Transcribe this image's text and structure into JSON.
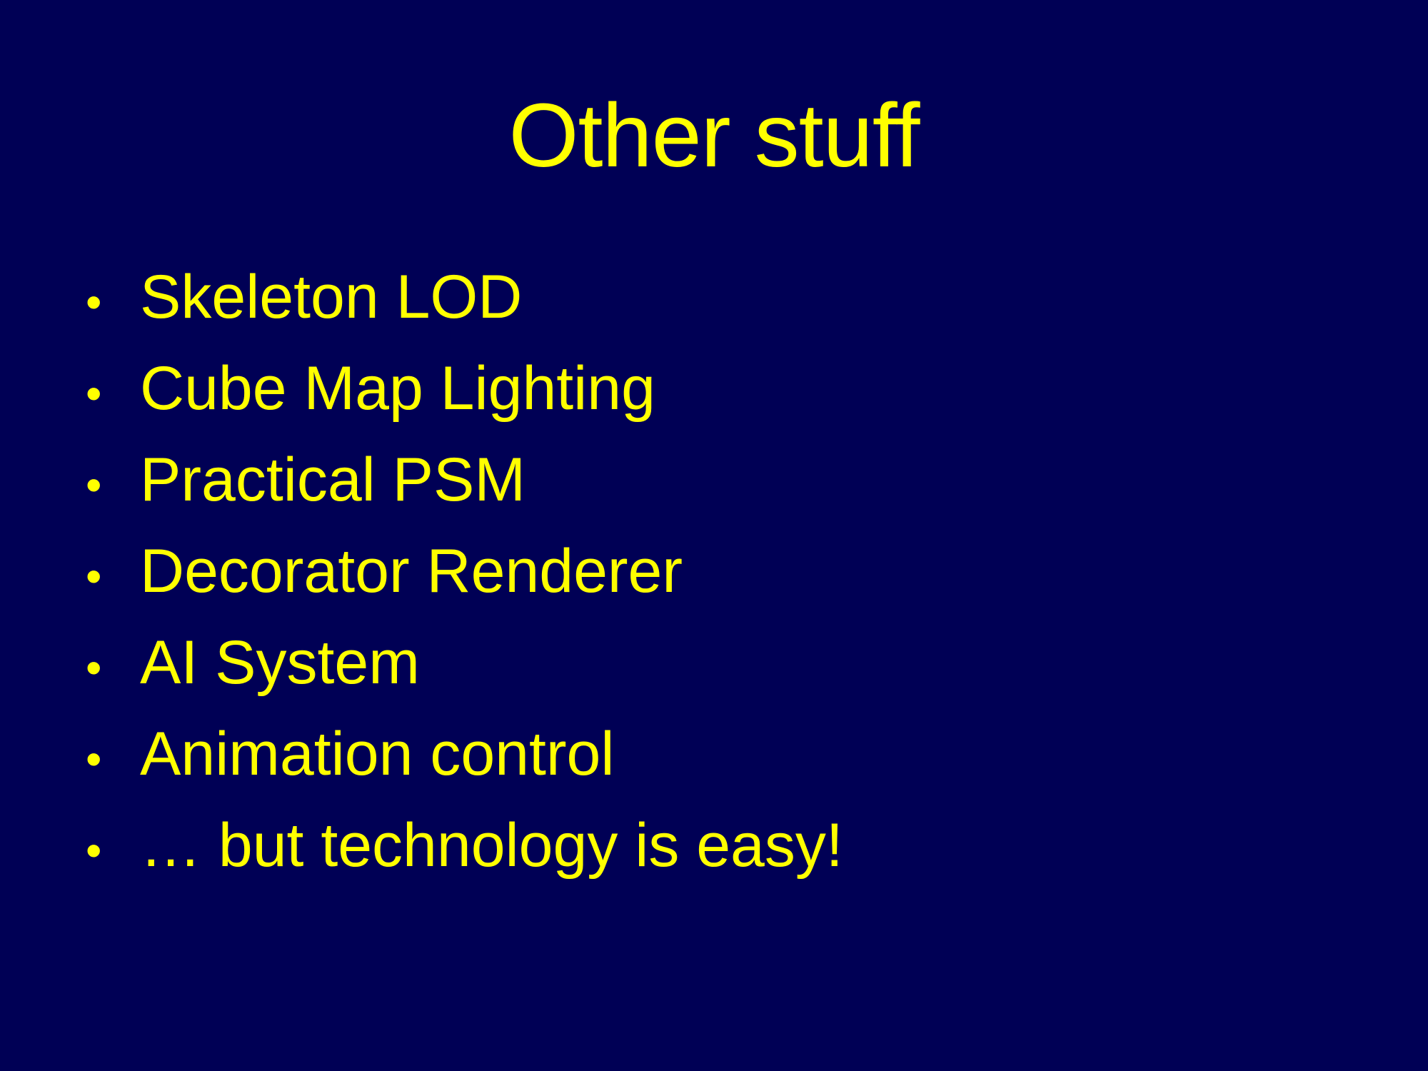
{
  "slide": {
    "title": "Other stuff",
    "background_color": "#000055",
    "text_color": "#FFFF00",
    "bullet_symbol": "•",
    "bullets": [
      "Skeleton LOD",
      "Cube Map Lighting",
      "Practical PSM",
      "Decorator Renderer",
      "AI System",
      "Animation control",
      "… but technology is easy!"
    ]
  }
}
